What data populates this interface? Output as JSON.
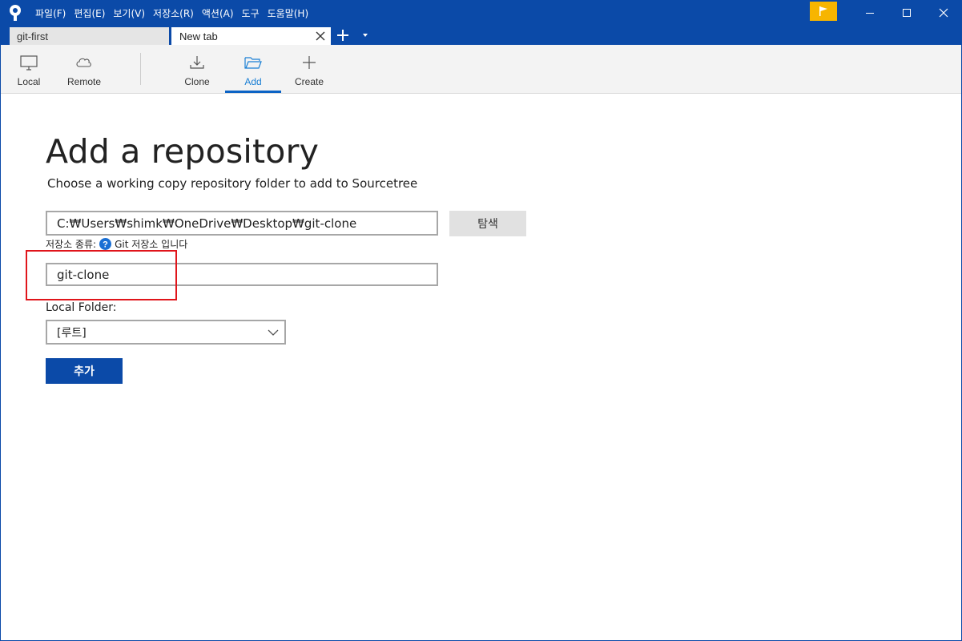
{
  "menu": {
    "items": [
      "파일(F)",
      "편집(E)",
      "보기(V)",
      "저장소(R)",
      "액션(A)",
      "도구",
      "도움말(H)"
    ]
  },
  "tabs": [
    {
      "label": "git-first",
      "active": false
    },
    {
      "label": "New tab",
      "active": true
    }
  ],
  "toolbar": {
    "local_label": "Local",
    "remote_label": "Remote",
    "clone_label": "Clone",
    "add_label": "Add",
    "create_label": "Create",
    "active": "Add"
  },
  "main": {
    "title": "Add a repository",
    "subtitle": "Choose a working copy repository folder to add to Sourcetree",
    "path_value": "C:₩Users₩shimk₩OneDrive₩Desktop₩git-clone",
    "browse_label": "탐색",
    "repo_type_label": "저장소 종류:",
    "repo_type_value": "Git 저장소 입니다",
    "name_value": "git-clone",
    "local_folder_label": "Local Folder:",
    "local_folder_selected": "[루트]",
    "add_button_label": "추가"
  },
  "colors": {
    "titlebar": "#0b4aa8",
    "accent": "#1a7fd4",
    "flag": "#f7b500",
    "highlight": "#e0151b"
  }
}
